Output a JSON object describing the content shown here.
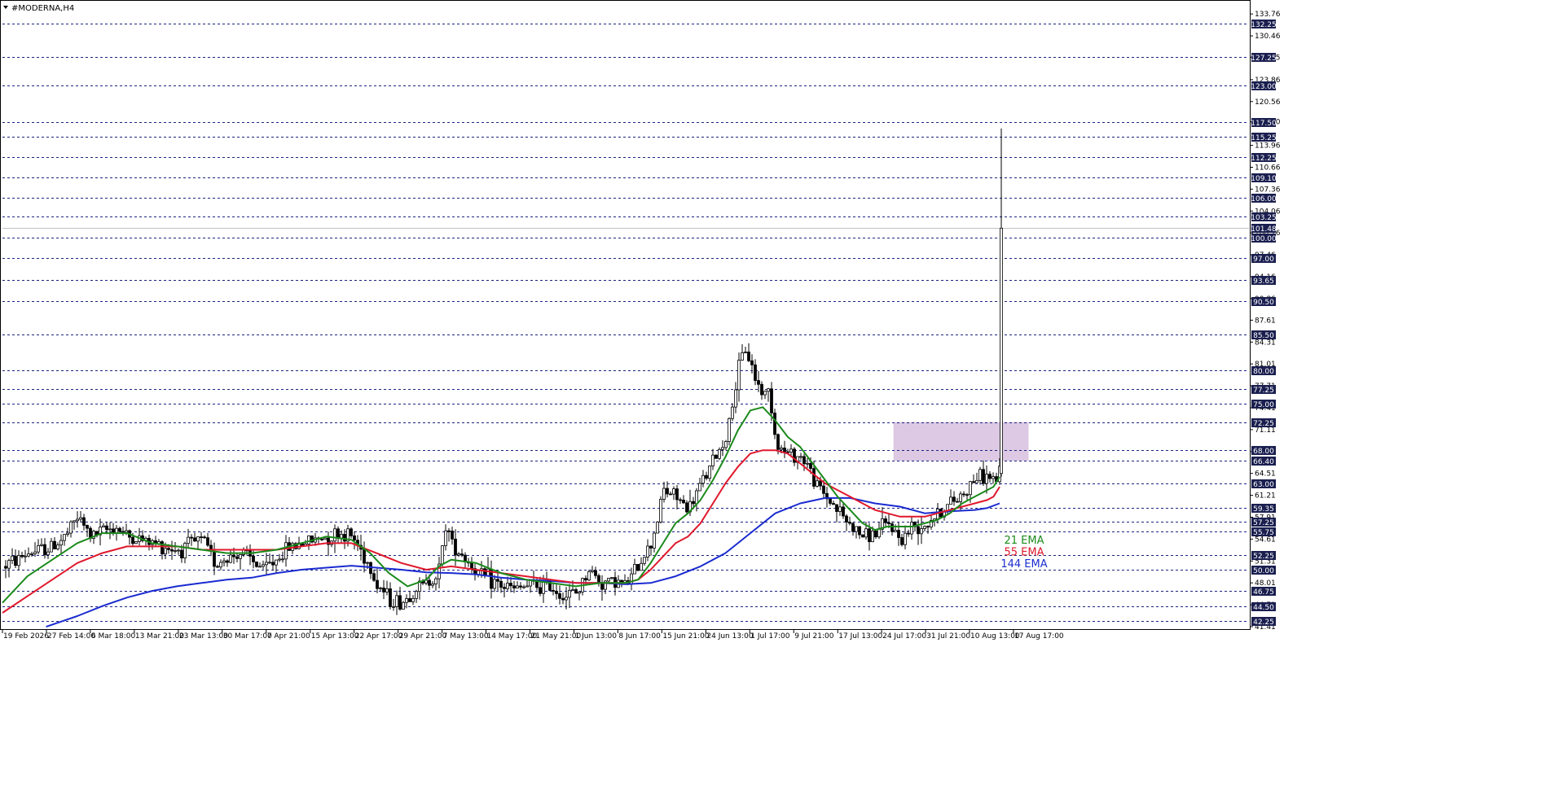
{
  "window": {
    "title": "#MODERNA,H4",
    "menu_icon": "triangle-down-icon"
  },
  "colors": {
    "background": "#ffffff",
    "axis": "#000000",
    "candle": "#000000",
    "level_line": "#1a237e",
    "level_label_bg": "#1a1f4f",
    "ema21": "#1b8a1b",
    "ema55": "#e0182c",
    "ema144": "#1a2bd0",
    "zone": "#d7bfdf",
    "current_price_line": "#c0c0c0"
  },
  "chart_data": {
    "type": "candlestick",
    "title": "#MODERNA,H4",
    "y_range": [
      41.41,
      135.5
    ],
    "price_ticks": [
      "133.76",
      "130.46",
      "127.25",
      "123.86",
      "120.56",
      "117.50",
      "113.96",
      "110.66",
      "107.36",
      "104.06",
      "100.76",
      "97.46",
      "94.16",
      "90.86",
      "87.61",
      "84.31",
      "81.01",
      "77.71",
      "74.41",
      "71.11",
      "67.81",
      "64.51",
      "61.21",
      "57.91",
      "54.61",
      "51.31",
      "48.01",
      "44.71",
      "41.41"
    ],
    "price_tick_values": [
      133.76,
      130.46,
      127.25,
      123.86,
      120.56,
      117.5,
      113.96,
      110.66,
      107.36,
      104.06,
      100.76,
      97.46,
      94.16,
      90.86,
      87.61,
      84.31,
      81.01,
      77.71,
      74.41,
      71.11,
      67.81,
      64.51,
      61.21,
      57.91,
      54.61,
      51.31,
      48.01,
      44.71,
      41.41
    ],
    "levels": [
      {
        "label": "132.25",
        "value": 132.25
      },
      {
        "label": "127.25",
        "value": 127.25
      },
      {
        "label": "123.00",
        "value": 123.0
      },
      {
        "label": "117.50",
        "value": 117.5
      },
      {
        "label": "115.25",
        "value": 115.25
      },
      {
        "label": "112.25",
        "value": 112.25
      },
      {
        "label": "109.10",
        "value": 109.1
      },
      {
        "label": "106.00",
        "value": 106.0
      },
      {
        "label": "103.25",
        "value": 103.25
      },
      {
        "label": "100.00",
        "value": 100.0
      },
      {
        "label": "97.00",
        "value": 97.0
      },
      {
        "label": "93.65",
        "value": 93.65
      },
      {
        "label": "90.50",
        "value": 90.5
      },
      {
        "label": "85.50",
        "value": 85.5
      },
      {
        "label": "80.00",
        "value": 80.0
      },
      {
        "label": "77.25",
        "value": 77.25
      },
      {
        "label": "75.00",
        "value": 75.0
      },
      {
        "label": "72.25",
        "value": 72.25
      },
      {
        "label": "68.00",
        "value": 68.0
      },
      {
        "label": "66.40",
        "value": 66.4
      },
      {
        "label": "63.00",
        "value": 63.0
      },
      {
        "label": "59.35",
        "value": 59.35
      },
      {
        "label": "57.25",
        "value": 57.25
      },
      {
        "label": "55.75",
        "value": 55.75
      },
      {
        "label": "52.25",
        "value": 52.25
      },
      {
        "label": "50.00",
        "value": 50.0
      },
      {
        "label": "46.75",
        "value": 46.75
      },
      {
        "label": "44.50",
        "value": 44.5
      },
      {
        "label": "42.25",
        "value": 42.25
      }
    ],
    "current_price": {
      "label": "101.48",
      "value": 101.48
    },
    "zone": {
      "x_start": 0.7148,
      "x_end": 0.8232,
      "y_low": 66.4,
      "y_high": 72.25
    },
    "time_ticks": [
      "19 Feb 2026",
      "27 Feb 14:00",
      "6 Mar 18:00",
      "13 Mar 21:00",
      "23 Mar 13:00",
      "30 Mar 17:00",
      "7 Apr 21:00",
      "15 Apr 13:00",
      "22 Apr 17:00",
      "29 Apr 21:00",
      "7 May 13:00",
      "14 May 17:00",
      "21 May 21:00",
      "1 Jun 13:00",
      "8 Jun 17:00",
      "15 Jun 21:00",
      "24 Jun 13:00",
      "1 Jul 17:00",
      "9 Jul 21:00",
      "17 Jul 13:00",
      "24 Jul 17:00",
      "31 Jul 21:00",
      "10 Aug 13:00",
      "17 Aug 17:00"
    ],
    "time_tick_fractions": [
      0.0,
      0.0353,
      0.0705,
      0.1058,
      0.1411,
      0.1763,
      0.2116,
      0.2469,
      0.2821,
      0.3174,
      0.3527,
      0.3879,
      0.4232,
      0.4585,
      0.4937,
      0.529,
      0.5643,
      0.5995,
      0.6348,
      0.6701,
      0.7053,
      0.7406,
      0.7758,
      0.8111
    ],
    "price_path": [
      [
        0.0,
        50.5
      ],
      [
        0.02,
        52.5
      ],
      [
        0.04,
        53.5
      ],
      [
        0.05,
        55.0
      ],
      [
        0.06,
        58.0
      ],
      [
        0.07,
        55.0
      ],
      [
        0.09,
        56.5
      ],
      [
        0.1,
        55.0
      ],
      [
        0.12,
        54.0
      ],
      [
        0.14,
        53.0
      ],
      [
        0.16,
        54.5
      ],
      [
        0.17,
        51.0
      ],
      [
        0.19,
        52.5
      ],
      [
        0.21,
        50.0
      ],
      [
        0.23,
        53.5
      ],
      [
        0.25,
        54.5
      ],
      [
        0.27,
        55.5
      ],
      [
        0.28,
        55.0
      ],
      [
        0.29,
        52.0
      ],
      [
        0.3,
        48.0
      ],
      [
        0.31,
        45.5
      ],
      [
        0.32,
        45.0
      ],
      [
        0.33,
        47.0
      ],
      [
        0.34,
        48.0
      ],
      [
        0.35,
        50.0
      ],
      [
        0.355,
        57.0
      ],
      [
        0.36,
        54.0
      ],
      [
        0.37,
        52.0
      ],
      [
        0.38,
        49.5
      ],
      [
        0.39,
        48.5
      ],
      [
        0.4,
        47.5
      ],
      [
        0.41,
        47.0
      ],
      [
        0.42,
        47.5
      ],
      [
        0.43,
        47.5
      ],
      [
        0.44,
        47.5
      ],
      [
        0.45,
        46.0
      ],
      [
        0.46,
        46.5
      ],
      [
        0.47,
        50.0
      ],
      [
        0.48,
        48.0
      ],
      [
        0.49,
        48.5
      ],
      [
        0.5,
        47.5
      ],
      [
        0.51,
        51.0
      ],
      [
        0.52,
        54.0
      ],
      [
        0.53,
        62.0
      ],
      [
        0.54,
        61.0
      ],
      [
        0.55,
        59.0
      ],
      [
        0.56,
        63.0
      ],
      [
        0.57,
        66.5
      ],
      [
        0.58,
        70.0
      ],
      [
        0.59,
        80.0
      ],
      [
        0.595,
        83.5
      ],
      [
        0.6,
        81.0
      ],
      [
        0.605,
        78.0
      ],
      [
        0.61,
        76.5
      ],
      [
        0.615,
        77.0
      ],
      [
        0.62,
        69.0
      ],
      [
        0.625,
        68.0
      ],
      [
        0.63,
        67.5
      ],
      [
        0.64,
        67.0
      ],
      [
        0.645,
        66.0
      ],
      [
        0.65,
        63.5
      ],
      [
        0.66,
        61.0
      ],
      [
        0.67,
        59.0
      ],
      [
        0.68,
        56.5
      ],
      [
        0.69,
        55.0
      ],
      [
        0.7,
        55.5
      ],
      [
        0.71,
        57.0
      ],
      [
        0.72,
        54.5
      ],
      [
        0.73,
        56.5
      ],
      [
        0.74,
        57.0
      ],
      [
        0.75,
        58.5
      ],
      [
        0.76,
        60.0
      ],
      [
        0.77,
        61.5
      ],
      [
        0.78,
        64.0
      ],
      [
        0.79,
        64.0
      ],
      [
        0.795,
        63.5
      ],
      [
        0.8,
        64.5
      ]
    ],
    "spike": {
      "x": 0.8,
      "open": 64.5,
      "high": 116.5,
      "low": 64.0,
      "close": 101.48
    },
    "ema21_path": [
      [
        0.0,
        45.0
      ],
      [
        0.02,
        49.0
      ],
      [
        0.04,
        51.5
      ],
      [
        0.06,
        54.0
      ],
      [
        0.08,
        55.5
      ],
      [
        0.1,
        55.5
      ],
      [
        0.12,
        54.0
      ],
      [
        0.14,
        53.5
      ],
      [
        0.16,
        53.0
      ],
      [
        0.18,
        52.5
      ],
      [
        0.2,
        52.5
      ],
      [
        0.22,
        53.0
      ],
      [
        0.24,
        54.0
      ],
      [
        0.26,
        55.0
      ],
      [
        0.28,
        54.5
      ],
      [
        0.295,
        52.5
      ],
      [
        0.31,
        49.5
      ],
      [
        0.325,
        47.5
      ],
      [
        0.34,
        48.5
      ],
      [
        0.35,
        50.5
      ],
      [
        0.36,
        51.5
      ],
      [
        0.38,
        51.0
      ],
      [
        0.4,
        49.5
      ],
      [
        0.42,
        48.5
      ],
      [
        0.44,
        48.0
      ],
      [
        0.46,
        47.5
      ],
      [
        0.48,
        48.0
      ],
      [
        0.5,
        48.0
      ],
      [
        0.51,
        48.5
      ],
      [
        0.52,
        51.0
      ],
      [
        0.53,
        54.0
      ],
      [
        0.54,
        57.0
      ],
      [
        0.55,
        58.5
      ],
      [
        0.56,
        60.5
      ],
      [
        0.57,
        63.5
      ],
      [
        0.58,
        67.0
      ],
      [
        0.59,
        71.0
      ],
      [
        0.6,
        74.0
      ],
      [
        0.61,
        74.5
      ],
      [
        0.62,
        72.5
      ],
      [
        0.63,
        70.0
      ],
      [
        0.64,
        68.5
      ],
      [
        0.65,
        66.0
      ],
      [
        0.66,
        63.5
      ],
      [
        0.67,
        61.0
      ],
      [
        0.68,
        59.0
      ],
      [
        0.69,
        57.0
      ],
      [
        0.7,
        56.0
      ],
      [
        0.71,
        56.5
      ],
      [
        0.72,
        56.5
      ],
      [
        0.73,
        56.5
      ],
      [
        0.74,
        57.0
      ],
      [
        0.75,
        57.5
      ],
      [
        0.76,
        58.5
      ],
      [
        0.77,
        60.0
      ],
      [
        0.78,
        61.0
      ],
      [
        0.79,
        62.0
      ],
      [
        0.795,
        62.5
      ],
      [
        0.8,
        64.0
      ]
    ],
    "ema55_path": [
      [
        0.0,
        43.5
      ],
      [
        0.02,
        46.0
      ],
      [
        0.04,
        48.5
      ],
      [
        0.06,
        51.0
      ],
      [
        0.08,
        52.5
      ],
      [
        0.1,
        53.5
      ],
      [
        0.12,
        53.5
      ],
      [
        0.14,
        53.5
      ],
      [
        0.16,
        53.0
      ],
      [
        0.18,
        53.0
      ],
      [
        0.2,
        53.0
      ],
      [
        0.22,
        53.0
      ],
      [
        0.24,
        53.5
      ],
      [
        0.26,
        54.0
      ],
      [
        0.28,
        54.0
      ],
      [
        0.3,
        52.5
      ],
      [
        0.32,
        51.0
      ],
      [
        0.34,
        50.0
      ],
      [
        0.36,
        50.5
      ],
      [
        0.38,
        50.0
      ],
      [
        0.4,
        49.5
      ],
      [
        0.42,
        49.0
      ],
      [
        0.44,
        48.5
      ],
      [
        0.46,
        48.0
      ],
      [
        0.48,
        48.0
      ],
      [
        0.5,
        48.0
      ],
      [
        0.51,
        48.5
      ],
      [
        0.52,
        50.0
      ],
      [
        0.53,
        52.0
      ],
      [
        0.54,
        54.0
      ],
      [
        0.55,
        55.0
      ],
      [
        0.56,
        57.0
      ],
      [
        0.57,
        60.0
      ],
      [
        0.58,
        63.0
      ],
      [
        0.59,
        65.5
      ],
      [
        0.6,
        67.5
      ],
      [
        0.61,
        68.0
      ],
      [
        0.62,
        68.0
      ],
      [
        0.63,
        67.5
      ],
      [
        0.64,
        66.0
      ],
      [
        0.65,
        64.5
      ],
      [
        0.66,
        63.0
      ],
      [
        0.67,
        62.0
      ],
      [
        0.68,
        61.0
      ],
      [
        0.69,
        60.0
      ],
      [
        0.7,
        59.0
      ],
      [
        0.71,
        58.5
      ],
      [
        0.72,
        58.0
      ],
      [
        0.73,
        58.0
      ],
      [
        0.74,
        58.0
      ],
      [
        0.75,
        58.5
      ],
      [
        0.76,
        59.0
      ],
      [
        0.77,
        59.5
      ],
      [
        0.78,
        60.0
      ],
      [
        0.79,
        60.5
      ],
      [
        0.795,
        61.0
      ],
      [
        0.8,
        62.5
      ]
    ],
    "ema144_path": [
      [
        0.035,
        41.4
      ],
      [
        0.06,
        43.0
      ],
      [
        0.08,
        44.5
      ],
      [
        0.1,
        45.8
      ],
      [
        0.12,
        46.8
      ],
      [
        0.14,
        47.5
      ],
      [
        0.16,
        48.0
      ],
      [
        0.18,
        48.5
      ],
      [
        0.2,
        48.8
      ],
      [
        0.22,
        49.5
      ],
      [
        0.24,
        50.0
      ],
      [
        0.26,
        50.3
      ],
      [
        0.28,
        50.6
      ],
      [
        0.3,
        50.3
      ],
      [
        0.32,
        50.0
      ],
      [
        0.34,
        49.6
      ],
      [
        0.36,
        49.5
      ],
      [
        0.38,
        49.3
      ],
      [
        0.4,
        48.8
      ],
      [
        0.42,
        48.5
      ],
      [
        0.44,
        48.3
      ],
      [
        0.46,
        48.0
      ],
      [
        0.48,
        48.0
      ],
      [
        0.5,
        47.8
      ],
      [
        0.52,
        48.0
      ],
      [
        0.54,
        49.0
      ],
      [
        0.56,
        50.5
      ],
      [
        0.58,
        52.5
      ],
      [
        0.6,
        55.5
      ],
      [
        0.62,
        58.5
      ],
      [
        0.64,
        60.0
      ],
      [
        0.66,
        60.8
      ],
      [
        0.68,
        60.8
      ],
      [
        0.7,
        60.0
      ],
      [
        0.72,
        59.5
      ],
      [
        0.74,
        58.5
      ],
      [
        0.76,
        58.8
      ],
      [
        0.78,
        59.0
      ],
      [
        0.79,
        59.3
      ],
      [
        0.8,
        60.0
      ]
    ],
    "legend": [
      {
        "label": "21 EMA",
        "color": "#1b8a1b"
      },
      {
        "label": "55 EMA",
        "color": "#e0182c"
      },
      {
        "label": "144 EMA",
        "color": "#1a2bd0"
      }
    ]
  }
}
